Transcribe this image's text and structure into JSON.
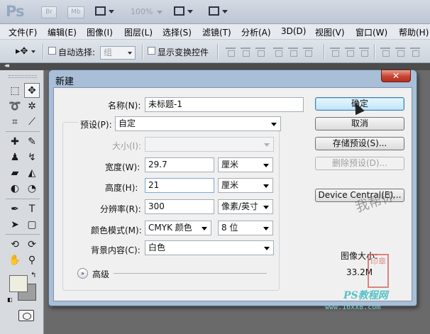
{
  "app": {
    "logo": "Ps",
    "bridge_label": "Br",
    "minibridge_label": "Mb",
    "zoom": "100%"
  },
  "menu": [
    "文件(F)",
    "编辑(E)",
    "图像(I)",
    "图层(L)",
    "选择(S)",
    "滤镜(T)",
    "分析(A)",
    "3D(D)",
    "视图(V)",
    "窗口(W)",
    "帮助(H)"
  ],
  "options": {
    "move_tool_symbol": "▸✥",
    "auto_select_label": "自动选择:",
    "auto_select_value": "组",
    "show_transform_label": "显示变换控件",
    "tools_collapse": "◂◂"
  },
  "dialog": {
    "title": "新建",
    "close_symbol": "✕",
    "name_label": "名称(N):",
    "name_value": "未标题-1",
    "preset_label": "预设(P):",
    "preset_value": "自定",
    "size_label": "大小(I):",
    "size_value": "",
    "width_label": "宽度(W):",
    "width_value": "29.7",
    "width_unit": "厘米",
    "height_label": "高度(H):",
    "height_value": "21",
    "height_unit": "厘米",
    "resolution_label": "分辨率(R):",
    "resolution_value": "300",
    "resolution_unit": "像素/英寸",
    "color_mode_label": "颜色模式(M):",
    "color_mode_value": "CMYK 颜色",
    "bit_depth_value": "8 位",
    "background_label": "背景内容(C):",
    "background_value": "白色",
    "advanced_label": "高级",
    "advanced_symbol": "»",
    "buttons": {
      "ok": "确定",
      "cancel": "取消",
      "save_preset": "存储预设(S)...",
      "delete_preset": "删除预设(D)...",
      "device_central": "Device Central(E)..."
    },
    "image_size_label": "图像大小:",
    "image_size_value": "33.2M"
  },
  "watermark": {
    "text": "我帮你",
    "seal": "印章",
    "site_name": "PS教程网",
    "site_url": "www.16xx8.com"
  }
}
